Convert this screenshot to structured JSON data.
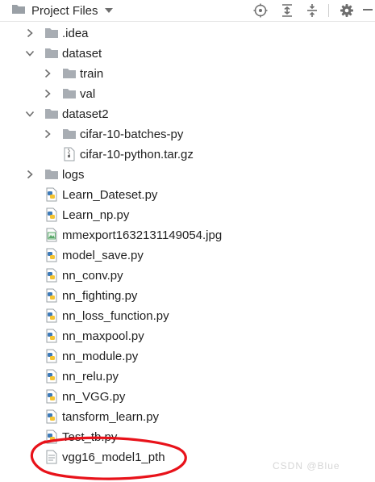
{
  "toolbar": {
    "title": "Project Files",
    "icons": [
      "project-folder-icon",
      "dropdown-arrow-icon",
      "locate-icon",
      "expand-all-icon",
      "collapse-all-icon",
      "settings-icon",
      "hide-icon"
    ]
  },
  "tree": {
    "items": [
      {
        "label": ".idea",
        "type": "folder",
        "depth": 1,
        "expander": "collapsed"
      },
      {
        "label": "dataset",
        "type": "folder",
        "depth": 1,
        "expander": "expanded"
      },
      {
        "label": "train",
        "type": "folder",
        "depth": 2,
        "expander": "collapsed"
      },
      {
        "label": "val",
        "type": "folder",
        "depth": 2,
        "expander": "collapsed"
      },
      {
        "label": "dataset2",
        "type": "folder",
        "depth": 1,
        "expander": "expanded"
      },
      {
        "label": "cifar-10-batches-py",
        "type": "folder",
        "depth": 2,
        "expander": "collapsed"
      },
      {
        "label": "cifar-10-python.tar.gz",
        "type": "archive",
        "depth": 2,
        "expander": "none"
      },
      {
        "label": "logs",
        "type": "folder",
        "depth": 1,
        "expander": "collapsed"
      },
      {
        "label": "Learn_Dateset.py",
        "type": "python",
        "depth": 1,
        "expander": "none"
      },
      {
        "label": "Learn_np.py",
        "type": "python",
        "depth": 1,
        "expander": "none"
      },
      {
        "label": "mmexport1632131149054.jpg",
        "type": "image",
        "depth": 1,
        "expander": "none"
      },
      {
        "label": "model_save.py",
        "type": "python",
        "depth": 1,
        "expander": "none"
      },
      {
        "label": "nn_conv.py",
        "type": "python",
        "depth": 1,
        "expander": "none"
      },
      {
        "label": "nn_fighting.py",
        "type": "python",
        "depth": 1,
        "expander": "none"
      },
      {
        "label": "nn_loss_function.py",
        "type": "python",
        "depth": 1,
        "expander": "none"
      },
      {
        "label": "nn_maxpool.py",
        "type": "python",
        "depth": 1,
        "expander": "none"
      },
      {
        "label": "nn_module.py",
        "type": "python",
        "depth": 1,
        "expander": "none"
      },
      {
        "label": "nn_relu.py",
        "type": "python",
        "depth": 1,
        "expander": "none"
      },
      {
        "label": "nn_VGG.py",
        "type": "python",
        "depth": 1,
        "expander": "none"
      },
      {
        "label": "tansform_learn.py",
        "type": "python",
        "depth": 1,
        "expander": "none"
      },
      {
        "label": "Test_tb.py",
        "type": "python",
        "depth": 1,
        "expander": "none"
      },
      {
        "label": "vgg16_model1_pth",
        "type": "binary",
        "depth": 1,
        "expander": "none"
      }
    ]
  },
  "annotation": {
    "shape": "red-ellipse",
    "color": "#e8121a",
    "target": "vgg16_model1_pth"
  },
  "watermark": "CSDN @Blue",
  "colors": {
    "folder": "#a8adb3",
    "python_blue": "#3d7ab8",
    "python_yellow": "#f4c331",
    "image_green": "#59a869",
    "annotation": "#e8121a"
  }
}
